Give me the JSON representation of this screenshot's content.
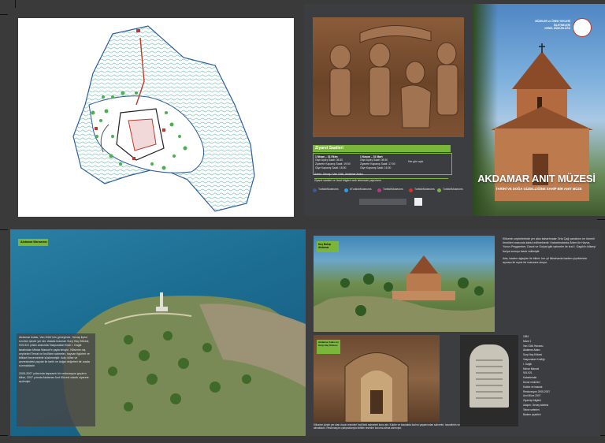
{
  "colors": {
    "accent_green": "#79b63a",
    "panel_dark": "#3b3d40",
    "sea": "#1f6f93",
    "title_white": "#ffffff"
  },
  "cover": {
    "institution_lines": [
      "MÜZELER ve ÖREN YERLERİ İŞLETMELERİ",
      "GENEL MÜDÜRLÜĞÜ"
    ],
    "title": "AKDAMAR ANIT MÜZESİ",
    "subtitle": "TARİHİ VE DOĞA GÜZELLİĞİNE SAHİP BİR ANIT MÜZE"
  },
  "visit": {
    "header": "Ziyaret Saatleri",
    "col1": {
      "title": "1 Nisan – 31 Ekim",
      "lines": [
        "Gişe Açılış Saati: 08:30",
        "Ziyarete Kapanış Saati: 19:00",
        "Gişe Kapanış Saati: 18:30"
      ]
    },
    "col2": {
      "title": "1 Kasım – 31 Mart",
      "lines": [
        "Gişe Açılış Saati: 08:30",
        "Ziyarete Kapanış Saati: 17:00",
        "Gişe Kapanış Saati: 16:30"
      ]
    },
    "col3": "Her gün açık",
    "address": "Adres: Gevaş / Van Gölü, Akdamar Adası",
    "note": "Ziyaret saatleri ve ücret bilgileri web sitemizde yayınlanır.",
    "socials": [
      "TurkishMuseums",
      "#TurkishMuseums",
      "TurkishMuseums",
      "TurkishMuseums",
      "TurkishMuseums"
    ]
  },
  "inner": {
    "label_left": "Akdamar Manzarası",
    "label_top": "Kuş Bakışı Akdamar",
    "label_mid": "Akdamar Adası ve Surp Haç Kilisesi",
    "left_para1": "Akdamar Adası, Van Gölü'nün güneyinde, Gevaş ilçesi sınırları içinde yer alır. Adada bulunan Surp Haç Kilisesi, 915-921 yılları arasında Vaspurakan Kralı I. Gagik tarafından Mimar Manuel'e yaptırılmıştır. Kilisenin dış cepheleri Tevrat ve İncil'den sahneler, hayvan figürleri ve bitkisel bezemelerle süslenmiştir. Ada, kilise ve çevresindeki yapılar ile tarihi ve doğal değerleri bir arada sunmaktadır.",
    "left_para2": "2005-2007 yıllarında kapsamlı bir restorasyon geçiren kilise, 2007 yılında Akdamar Anıt Müzesi olarak ziyarete açılmıştır.",
    "top_para": "Kilisenin cephelerinde yer alan kabartmalar Orta Çağ sanatının en önemli örnekleri arasında kabul edilmektedir. Kabartmalarda Âdem ile Havva, Yunus Peygamber, Davut ve Golyat gibi sahneler ile kral I. Gagik'in kiliseyi İsa'ya sunuşu tasvir edilmiştir.",
    "top_para2": "Ada, badem ağaçları ile bilinir; her yıl ilkbaharda badem çiçeklerinin açması ile eşsiz bir manzara oluşur.",
    "bottom_para": "Kilisenin içinde yer alan duvar resimleri İncil'deki sahneleri konu alır. Kubbe ve kasnakta İsa'nın yaşamından sahneler, havarilerin ve azizlerin tasvirleri yer almaktadır. Restorasyon çalışmalarıyla birlikte resimler koruma altına alınmıştır.",
    "right_list": [
      "1984",
      "Müze 1",
      "Van Gölü Havzası",
      "Akdamar Adası",
      "Surp Haç Kilisesi",
      "Vaspurakan Krallığı",
      "I. Gagik",
      "Mimar Manuel",
      "915-921",
      "Kabartmalar",
      "Duvar resimleri",
      "Kubbe ve kasnak",
      "Restorasyon 2005-2007",
      "Anıt Müze 2007",
      "Ziyaretçi bilgileri",
      "Ulaşım: Gevaş iskelesi",
      "Tekne seferleri",
      "Badem çiçekleri"
    ]
  }
}
